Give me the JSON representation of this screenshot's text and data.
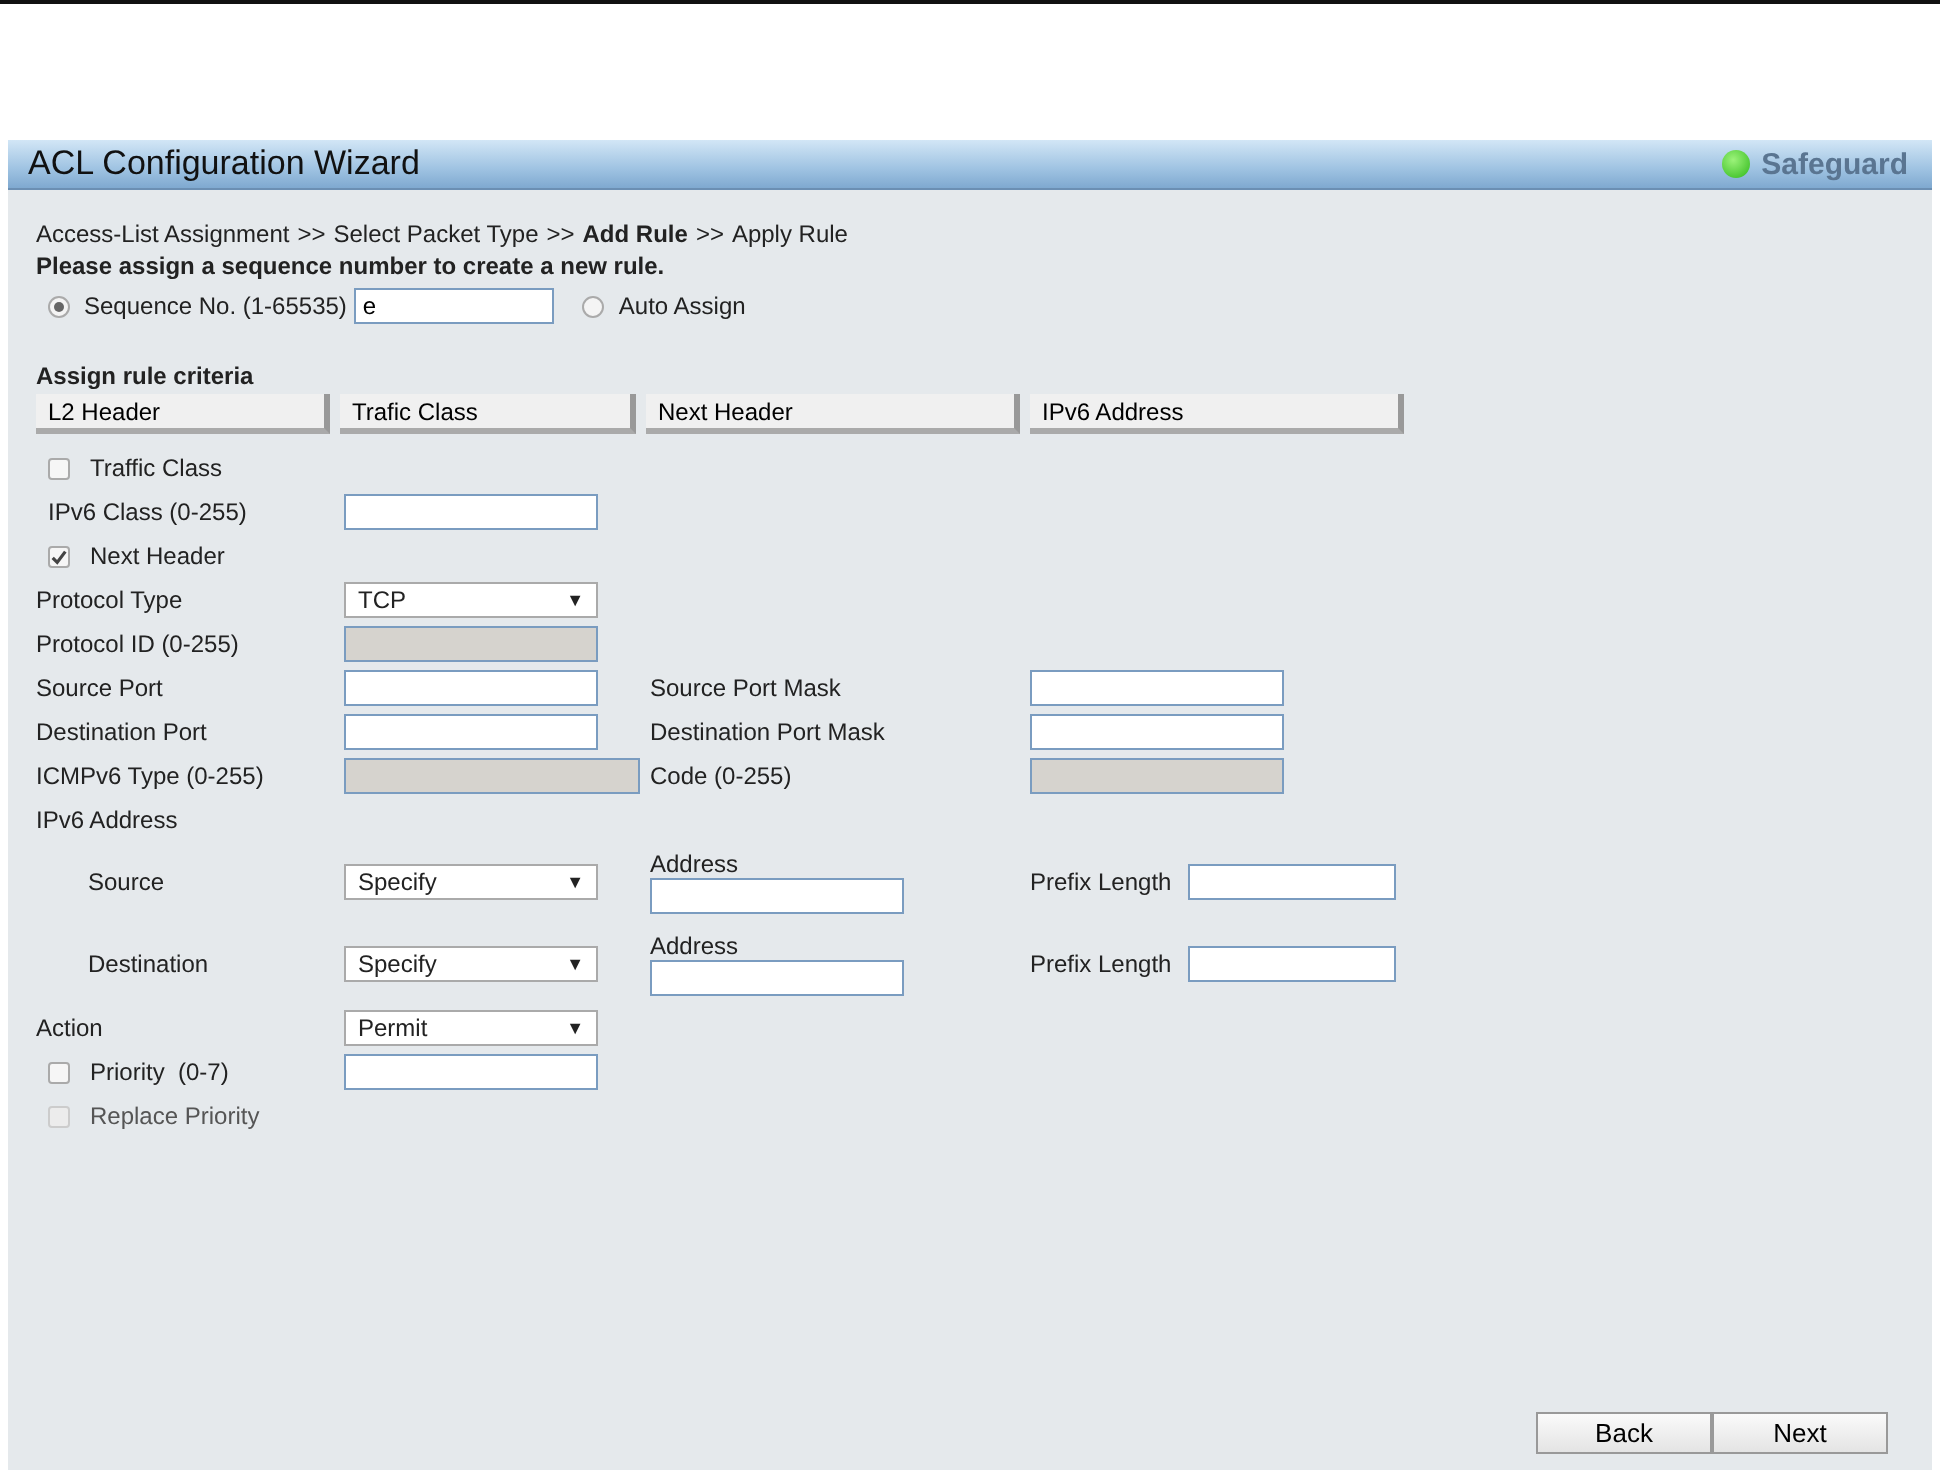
{
  "window": {
    "title": "ACL Configuration Wizard",
    "status": "Safeguard"
  },
  "breadcrumb": [
    {
      "label": "Access-List Assignment",
      "current": false
    },
    {
      "label": "Select Packet Type",
      "current": false
    },
    {
      "label": "Add Rule",
      "current": true
    },
    {
      "label": "Apply Rule",
      "current": false
    }
  ],
  "breadcrumb_separator": ">>",
  "instruction": "Please assign a sequence number to create a new rule.",
  "sequence": {
    "options": [
      {
        "label": "Sequence No. (1-65535)",
        "selected": true,
        "value": "e"
      },
      {
        "label": "Auto Assign",
        "selected": false
      }
    ]
  },
  "criteria_title": "Assign rule criteria",
  "tabs": [
    {
      "label": "L2 Header"
    },
    {
      "label": "Trafic Class"
    },
    {
      "label": "Next Header"
    },
    {
      "label": "IPv6 Address"
    }
  ],
  "rows": [
    {
      "kind": "check",
      "label": "Traffic Class",
      "checked": false,
      "disabled": false
    },
    {
      "kind": "fields",
      "label": "IPv6 Class (0-255)",
      "nested": true,
      "control": {
        "kind": "text",
        "disabled": false
      }
    },
    {
      "kind": "check",
      "label": "Next Header",
      "checked": true,
      "disabled": false
    },
    {
      "kind": "fields",
      "label": "Protocol Type",
      "control": {
        "kind": "select",
        "value": "TCP",
        "caret": "▼"
      }
    },
    {
      "kind": "fields",
      "label": "Protocol ID (0-255)",
      "control": {
        "kind": "text",
        "disabled": true
      }
    },
    {
      "kind": "fields",
      "label": "Source Port",
      "control": {
        "kind": "text",
        "disabled": false
      },
      "extra": {
        "label": "Source Port Mask",
        "control": {
          "kind": "text",
          "disabled": false
        }
      }
    },
    {
      "kind": "fields",
      "label": "Destination Port",
      "control": {
        "kind": "text",
        "disabled": false
      },
      "extra": {
        "label": "Destination Port Mask",
        "control": {
          "kind": "text",
          "disabled": false
        }
      }
    },
    {
      "kind": "fields",
      "label": "ICMPv6 Type (0-255)",
      "control": {
        "kind": "text",
        "disabled": true,
        "wide": true
      },
      "extra": {
        "label": "Code (0-255)",
        "control": {
          "kind": "text",
          "disabled": true
        }
      }
    },
    {
      "kind": "heading",
      "label": "IPv6 Address"
    },
    {
      "kind": "address",
      "label": "Source",
      "select": {
        "value": "Specify",
        "caret": "▼"
      },
      "address_label": "Address",
      "prefix_label": "Prefix Length"
    },
    {
      "kind": "address",
      "label": "Destination",
      "select": {
        "value": "Specify",
        "caret": "▼"
      },
      "address_label": "Address",
      "prefix_label": "Prefix Length"
    },
    {
      "kind": "fields",
      "label": "Action",
      "control": {
        "kind": "select",
        "value": "Permit",
        "caret": "▼"
      }
    },
    {
      "kind": "check_field",
      "label": "Priority  (0-7)",
      "checked": false
    },
    {
      "kind": "check",
      "label": "Replace Priority",
      "checked": false,
      "disabled": true
    }
  ],
  "buttons": [
    "Back",
    "Next"
  ]
}
